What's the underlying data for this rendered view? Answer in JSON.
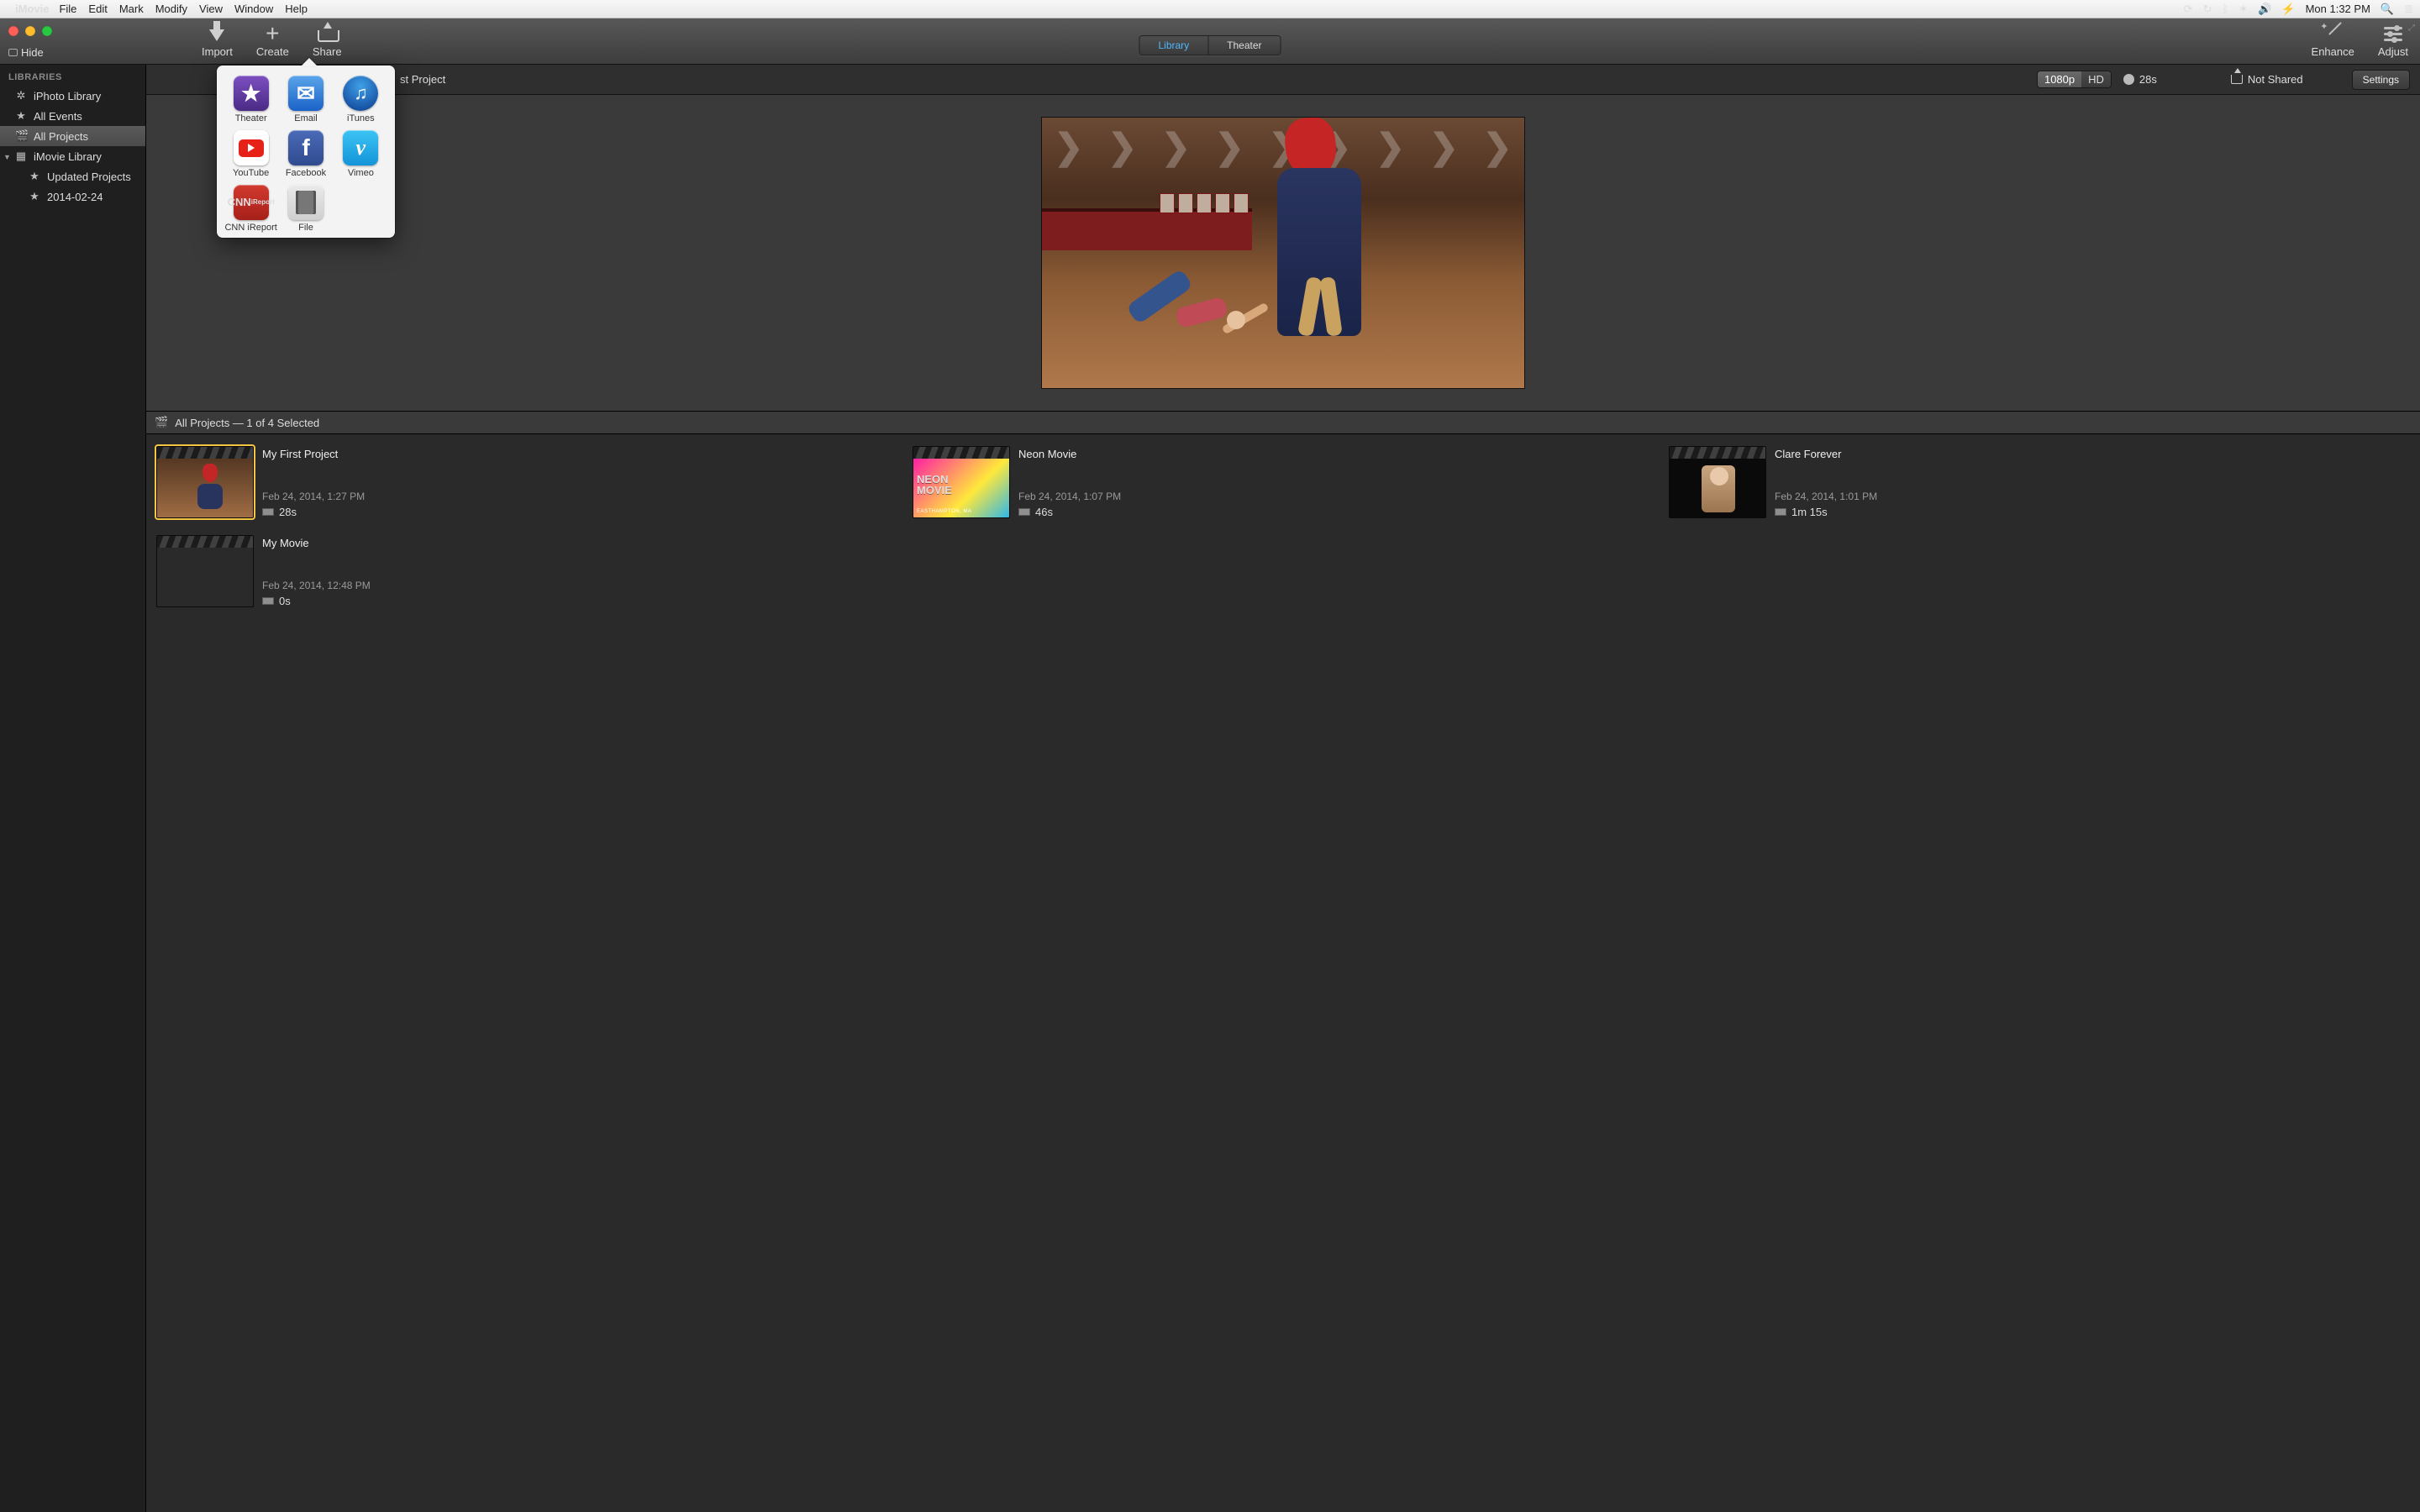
{
  "menubar": {
    "app": "iMovie",
    "items": [
      "File",
      "Edit",
      "Mark",
      "Modify",
      "View",
      "Window",
      "Help"
    ],
    "clock": "Mon 1:32 PM"
  },
  "toolbar": {
    "hide": "Hide",
    "import": "Import",
    "create": "Create",
    "share": "Share",
    "segment": {
      "library": "Library",
      "theater": "Theater"
    },
    "enhance": "Enhance",
    "adjust": "Adjust"
  },
  "sidebar": {
    "header": "LIBRARIES",
    "items": [
      {
        "label": "iPhoto Library",
        "icon": "✲"
      },
      {
        "label": "All Events",
        "icon": "★"
      },
      {
        "label": "All Projects",
        "icon": "🎬",
        "selected": true
      },
      {
        "label": "iMovie Library",
        "icon": "▦",
        "expandable": true
      },
      {
        "label": "Updated Projects",
        "icon": "★",
        "sub": true
      },
      {
        "label": "2014-02-24",
        "icon": "★",
        "sub": true
      }
    ]
  },
  "info": {
    "title_suffix": "st Project",
    "res_active": "1080p",
    "res_other": "HD",
    "duration": "28s",
    "share_state": "Not Shared",
    "settings": "Settings"
  },
  "browser": {
    "head": "All Projects — 1 of 4 Selected"
  },
  "projects": [
    {
      "title": "My First Project",
      "date": "Feb 24, 2014, 1:27 PM",
      "len": "28s",
      "sel": true,
      "thumb": "img1"
    },
    {
      "title": "Neon Movie",
      "date": "Feb 24, 2014, 1:07 PM",
      "len": "46s",
      "thumb": "img2",
      "neon1": "NEON",
      "neon2": "MOVIE",
      "neon3": "EASTHAMPTON, MA"
    },
    {
      "title": "Clare Forever",
      "date": "Feb 24, 2014, 1:01 PM",
      "len": "1m 15s",
      "thumb": "img3"
    },
    {
      "title": "My Movie",
      "date": "Feb 24, 2014, 12:48 PM",
      "len": "0s",
      "thumb": "img4"
    }
  ],
  "share_popover": {
    "items": [
      {
        "label": "Theater",
        "cls": "star"
      },
      {
        "label": "Email",
        "cls": "mail"
      },
      {
        "label": "iTunes",
        "cls": "itunes"
      },
      {
        "label": "YouTube",
        "cls": "youtube"
      },
      {
        "label": "Facebook",
        "cls": "fb"
      },
      {
        "label": "Vimeo",
        "cls": "vimeo"
      },
      {
        "label": "CNN iReport",
        "cls": "cnn",
        "text": "CNN"
      },
      {
        "label": "File",
        "cls": "file"
      }
    ]
  }
}
